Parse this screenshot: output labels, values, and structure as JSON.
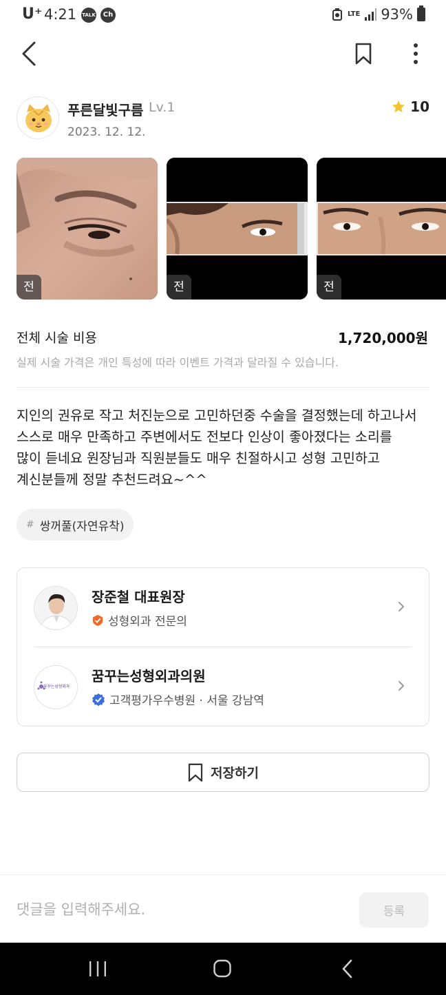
{
  "status_bar": {
    "carrier": "U⁺",
    "time": "4:21",
    "notifications": [
      "TALK",
      "Ch"
    ],
    "network": "LTE",
    "battery": "93%"
  },
  "nav": {
    "back_icon": "chevron-left-icon",
    "bookmark_icon": "bookmark-icon",
    "more_icon": "more-vertical-icon"
  },
  "author": {
    "name": "푸른달빛구름",
    "level": "Lv.1",
    "date": "2023. 12. 12.",
    "rating": "10",
    "star_color": "#f5c230"
  },
  "photos": [
    {
      "label": "전"
    },
    {
      "label": "전"
    },
    {
      "label": "전"
    }
  ],
  "cost": {
    "label": "전체 시술 비용",
    "value": "1,720,000원",
    "note": "실제 시술 가격은 개인 특성에 따라 이벤트 가격과 달라질 수 있습니다."
  },
  "review": {
    "lines": [
      "지인의 권유로 작고 처진눈으로 고민하던중 수술을 결정했는데 하고나서",
      "스스로 매우 만족하고 주변에서도 전보다 인상이 좋아졌다는 소리를",
      "많이 듣네요 원장님과 직원분들도 매우 친절하시고 성형 고민하고",
      "계신분들께 정말 추천드려요~^^"
    ]
  },
  "tag": {
    "hash": "#",
    "label": "쌍꺼풀(자연유착)"
  },
  "doctor": {
    "name": "장준철 대표원장",
    "specialty": "성형외과 전문의",
    "badge_color": "#f26a2a"
  },
  "clinic": {
    "name": "꿈꾸는성형외과의원",
    "info": "고객평가우수병원 · 서울 강남역",
    "logo_text": "꿈꾸는성형외과",
    "badge_color": "#3b6fe0"
  },
  "save_button": {
    "label": "저장하기"
  },
  "comment": {
    "placeholder": "댓글을 입력해주세요.",
    "submit_label": "등록"
  }
}
